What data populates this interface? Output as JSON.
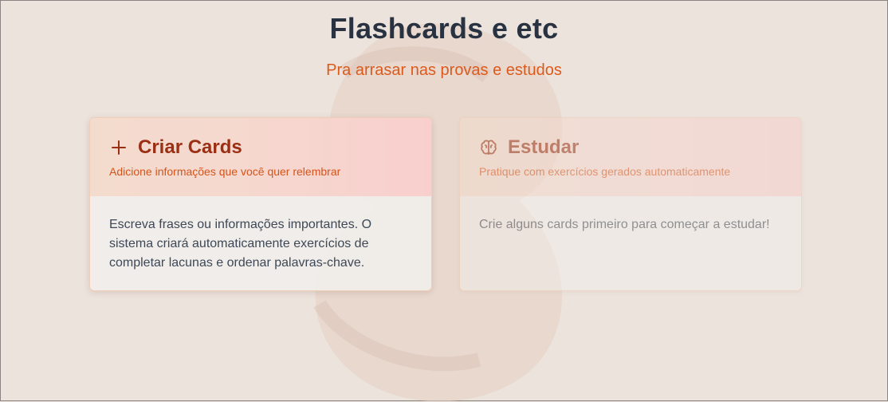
{
  "header": {
    "title": "Flashcards e etc",
    "subtitle": "Pra arrasar nas provas e estudos"
  },
  "cards": [
    {
      "title": "Criar Cards",
      "description": "Adicione informações que você quer relembrar",
      "body": "Escreva frases ou informações importantes. O sistema criará automaticamente exercícios de completar lacunas e ordenar palavras-chave.",
      "icon": "plus-icon"
    },
    {
      "title": "Estudar",
      "description": "Pratique com exercícios gerados automaticamente",
      "body": "Crie alguns cards primeiro para começar a estudar!",
      "icon": "brain-icon",
      "disabled": true
    }
  ],
  "colors": {
    "accent": "#dd5a1d",
    "card_title": "#9a2f14",
    "heading": "#283240",
    "background": "#ece3dc"
  }
}
